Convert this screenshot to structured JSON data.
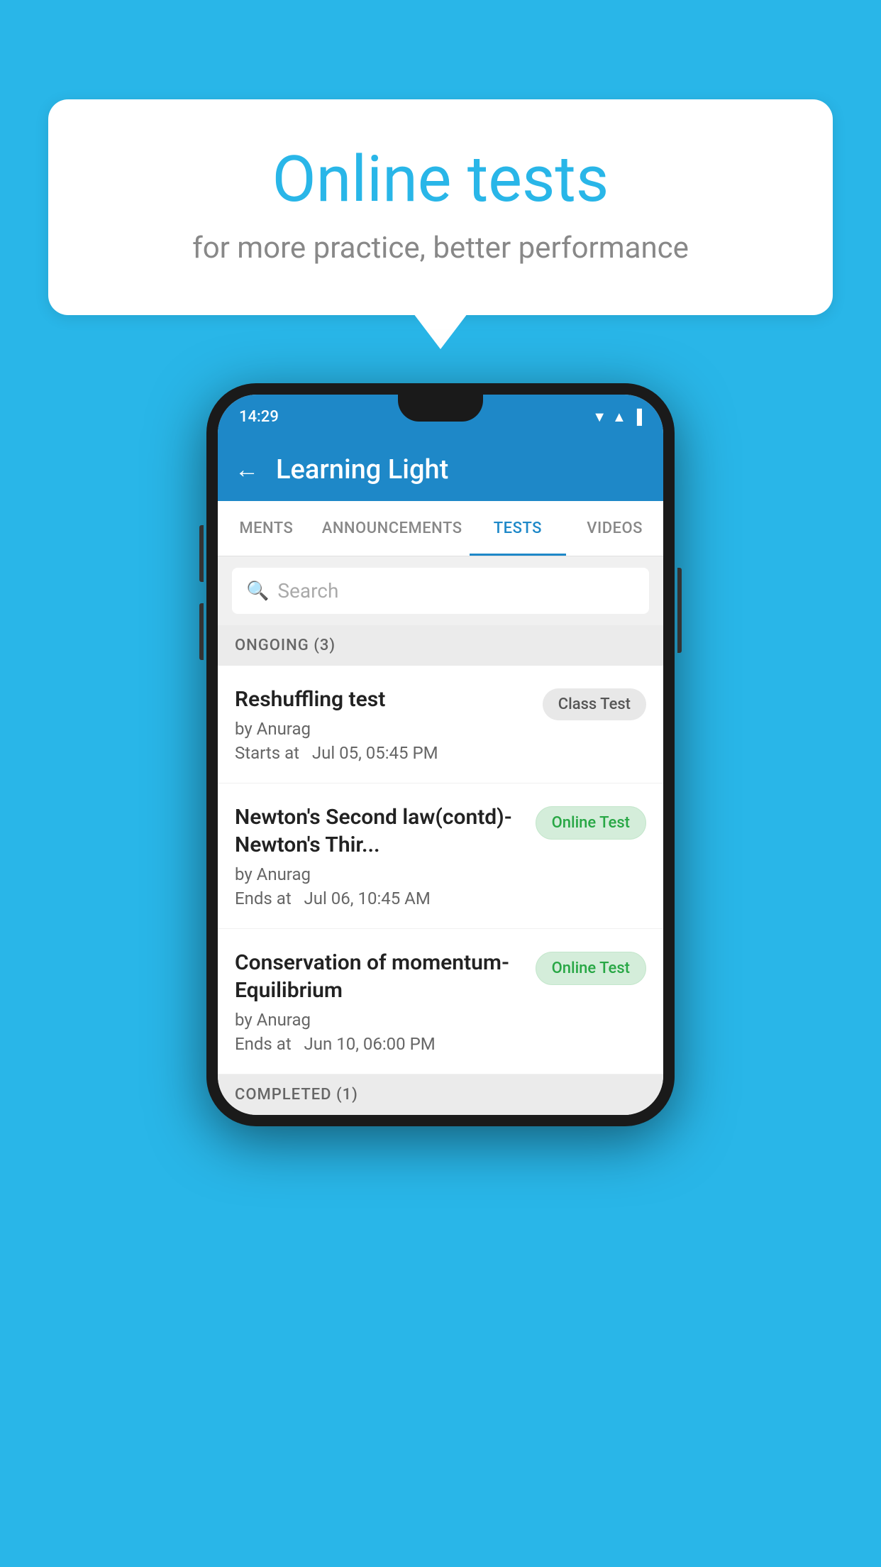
{
  "background": {
    "color": "#29b6e8"
  },
  "speech_bubble": {
    "title": "Online tests",
    "subtitle": "for more practice, better performance"
  },
  "phone": {
    "status_bar": {
      "time": "14:29",
      "icons": [
        "▲",
        "◀",
        "▐"
      ]
    },
    "header": {
      "back_label": "←",
      "title": "Learning Light"
    },
    "tabs": [
      {
        "label": "MENTS",
        "active": false
      },
      {
        "label": "ANNOUNCEMENTS",
        "active": false
      },
      {
        "label": "TESTS",
        "active": true
      },
      {
        "label": "VIDEOS",
        "active": false
      }
    ],
    "search": {
      "placeholder": "Search",
      "icon": "🔍"
    },
    "ongoing_section": {
      "label": "ONGOING (3)",
      "items": [
        {
          "title": "Reshuffling test",
          "author": "by Anurag",
          "time_label": "Starts at",
          "time": "Jul 05, 05:45 PM",
          "badge": "Class Test",
          "badge_type": "class"
        },
        {
          "title": "Newton's Second law(contd)-Newton's Thir...",
          "author": "by Anurag",
          "time_label": "Ends at",
          "time": "Jul 06, 10:45 AM",
          "badge": "Online Test",
          "badge_type": "online"
        },
        {
          "title": "Conservation of momentum-Equilibrium",
          "author": "by Anurag",
          "time_label": "Ends at",
          "time": "Jun 10, 06:00 PM",
          "badge": "Online Test",
          "badge_type": "online"
        }
      ]
    },
    "completed_section": {
      "label": "COMPLETED (1)"
    }
  }
}
